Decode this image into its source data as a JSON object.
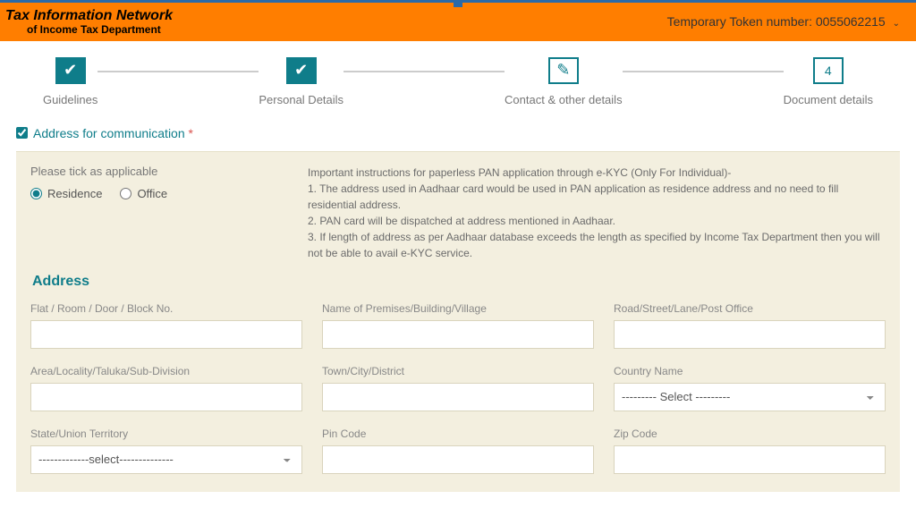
{
  "header": {
    "title_line1": "Tax Information Network",
    "title_line2": "of Income Tax Department",
    "token_label": "Temporary Token number:",
    "token_value": "0055062215"
  },
  "stepper": {
    "steps": [
      "Guidelines",
      "Personal Details",
      "Contact & other details",
      "Document details"
    ],
    "step4_number": "4"
  },
  "section": {
    "address_for_communication": "Address for communication",
    "required_mark": "*"
  },
  "info": {
    "please_tick": "Please tick as applicable",
    "residence": "Residence",
    "office": "Office",
    "heading": "Important instructions for paperless PAN application through e-KYC (Only For Individual)-",
    "line1": "1. The address used in Aadhaar card would be used in PAN application as residence address and no need to fill residential address.",
    "line2": "2. PAN card will be dispatched at address mentioned in Aadhaar.",
    "line3": "3. If length of address as per Aadhaar database exceeds the length as specified by Income Tax Department then you will not be able to avail e-KYC service."
  },
  "address": {
    "title": "Address",
    "fields": {
      "flat": "Flat / Room / Door / Block No.",
      "premises": "Name of Premises/Building/Village",
      "road": "Road/Street/Lane/Post Office",
      "area": "Area/Locality/Taluka/Sub-Division",
      "town": "Town/City/District",
      "country": "Country Name",
      "state": "State/Union Territory",
      "pin": "Pin Code",
      "zip": "Zip Code"
    },
    "country_placeholder": "--------- Select ---------",
    "state_placeholder": "-------------select--------------"
  }
}
